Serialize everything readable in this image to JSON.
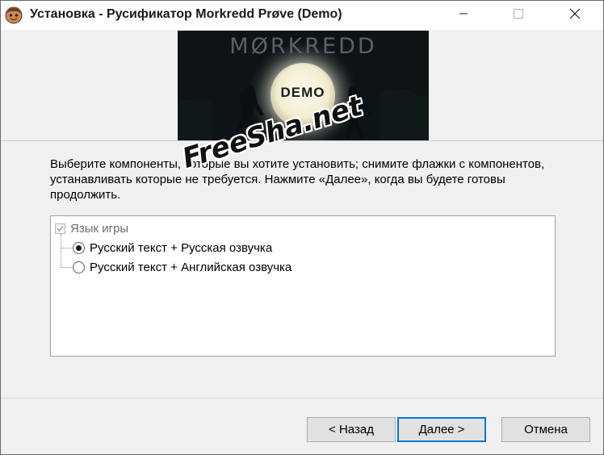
{
  "window": {
    "title": "Установка - Русификатор Morkredd Prøve (Demo)"
  },
  "banner": {
    "logo_text": "MØRKREDD",
    "demo_text": "DEMO"
  },
  "description": {
    "text": "Выберите компоненты, которые вы хотите установить; снимите флажки с компонентов, устанавливать которые не требуется. Нажмите «Далее», когда вы будете готовы продолжить."
  },
  "watermark": {
    "text": "FreeSha.net"
  },
  "components": {
    "root_label": "Язык игры",
    "options": [
      {
        "label": "Русский текст + Русская озвучка",
        "selected": true
      },
      {
        "label": "Русский текст + Английская озвучка",
        "selected": false
      }
    ]
  },
  "buttons": {
    "back": "< Назад",
    "next": "Далее >",
    "cancel": "Отмена"
  },
  "colors": {
    "accent": "#0078d7",
    "banner_bg": "#0e1416"
  },
  "icons": {
    "app": "installer-face-icon",
    "minimize": "minimize-icon",
    "maximize": "maximize-icon",
    "close": "close-icon"
  }
}
